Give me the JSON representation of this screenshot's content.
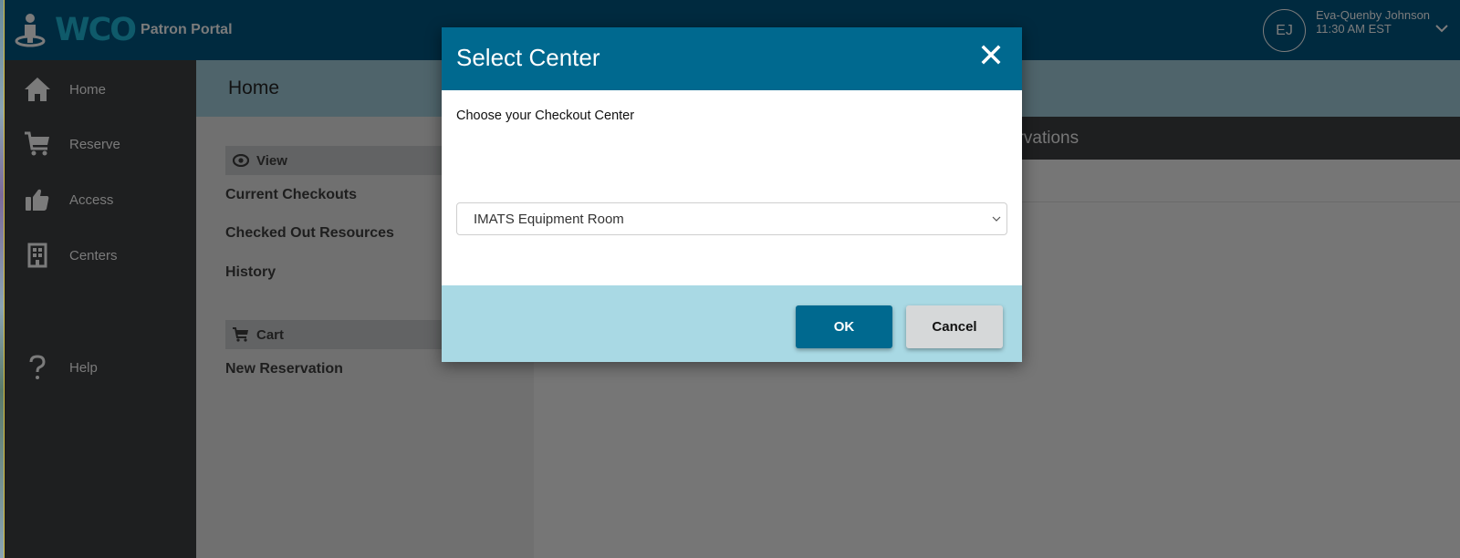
{
  "header": {
    "logo_text": "WCO",
    "logo_subtitle": "Patron Portal",
    "user": {
      "initials": "EJ",
      "name": "Eva-Quenby Johnson",
      "time": "11:30 AM EST"
    }
  },
  "sidebar": {
    "items": [
      {
        "label": "Home",
        "icon": "home-icon"
      },
      {
        "label": "Reserve",
        "icon": "cart-icon"
      },
      {
        "label": "Access",
        "icon": "thumbs-up-icon"
      },
      {
        "label": "Centers",
        "icon": "building-icon"
      },
      {
        "label": "Help",
        "icon": "question-icon"
      }
    ]
  },
  "page": {
    "title": "Home"
  },
  "left_panel": {
    "view_section": {
      "label": "View",
      "icon": "eye-icon",
      "links": [
        "Current Checkouts",
        "Checked Out Resources",
        "History"
      ]
    },
    "cart_section": {
      "label": "Cart",
      "icon": "cart-icon",
      "links": [
        "New Reservation"
      ]
    }
  },
  "main": {
    "section_title_visible": "ervations"
  },
  "modal": {
    "title": "Select Center",
    "prompt": "Choose your Checkout Center",
    "select_value": "IMATS Equipment Room",
    "ok_label": "OK",
    "cancel_label": "Cancel"
  },
  "colors": {
    "topbar": "#002a3f",
    "modal_header": "#00698f",
    "modal_footer": "#a9d9e4",
    "sidebar": "#1e1f20",
    "overlay_gray": "#767676"
  }
}
